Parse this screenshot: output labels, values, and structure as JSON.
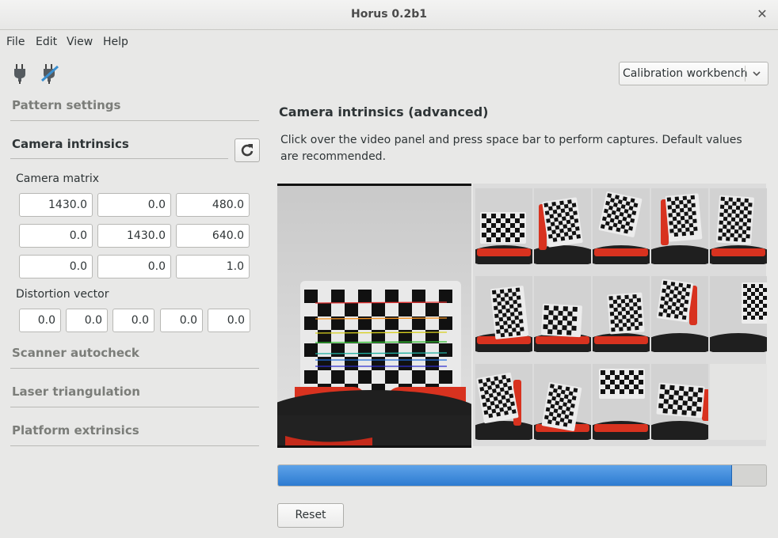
{
  "window": {
    "title": "Horus 0.2b1"
  },
  "menu": {
    "file": "File",
    "edit": "Edit",
    "view": "View",
    "help": "Help"
  },
  "toolbar": {
    "connect_icon": "plug-connected-icon",
    "disconnect_icon": "plug-disconnected-icon",
    "workbench": "Calibration workbench"
  },
  "sidebar": {
    "pattern_settings": "Pattern settings",
    "camera_intrinsics": "Camera intrinsics",
    "camera_matrix_label": "Camera matrix",
    "camera_matrix": [
      [
        "1430.0",
        "0.0",
        "480.0"
      ],
      [
        "0.0",
        "1430.0",
        "640.0"
      ],
      [
        "0.0",
        "0.0",
        "1.0"
      ]
    ],
    "distortion_label": "Distortion vector",
    "distortion_vector": [
      "0.0",
      "0.0",
      "0.0",
      "0.0",
      "0.0"
    ],
    "scanner_autocheck": "Scanner autocheck",
    "laser_triangulation": "Laser triangulation",
    "platform_extrinsics": "Platform extrinsics"
  },
  "main": {
    "title": "Camera intrinsics (advanced)",
    "description": "Click over the video panel and press space bar to perform captures. Default values are recommended.",
    "captures_taken": 14,
    "captures_total": 15,
    "progress": 0.93,
    "reset_label": "Reset"
  },
  "colors": {
    "accent": "#3584e4",
    "platform_red": "#d8321f",
    "platform_dark": "#1f1f1f"
  }
}
